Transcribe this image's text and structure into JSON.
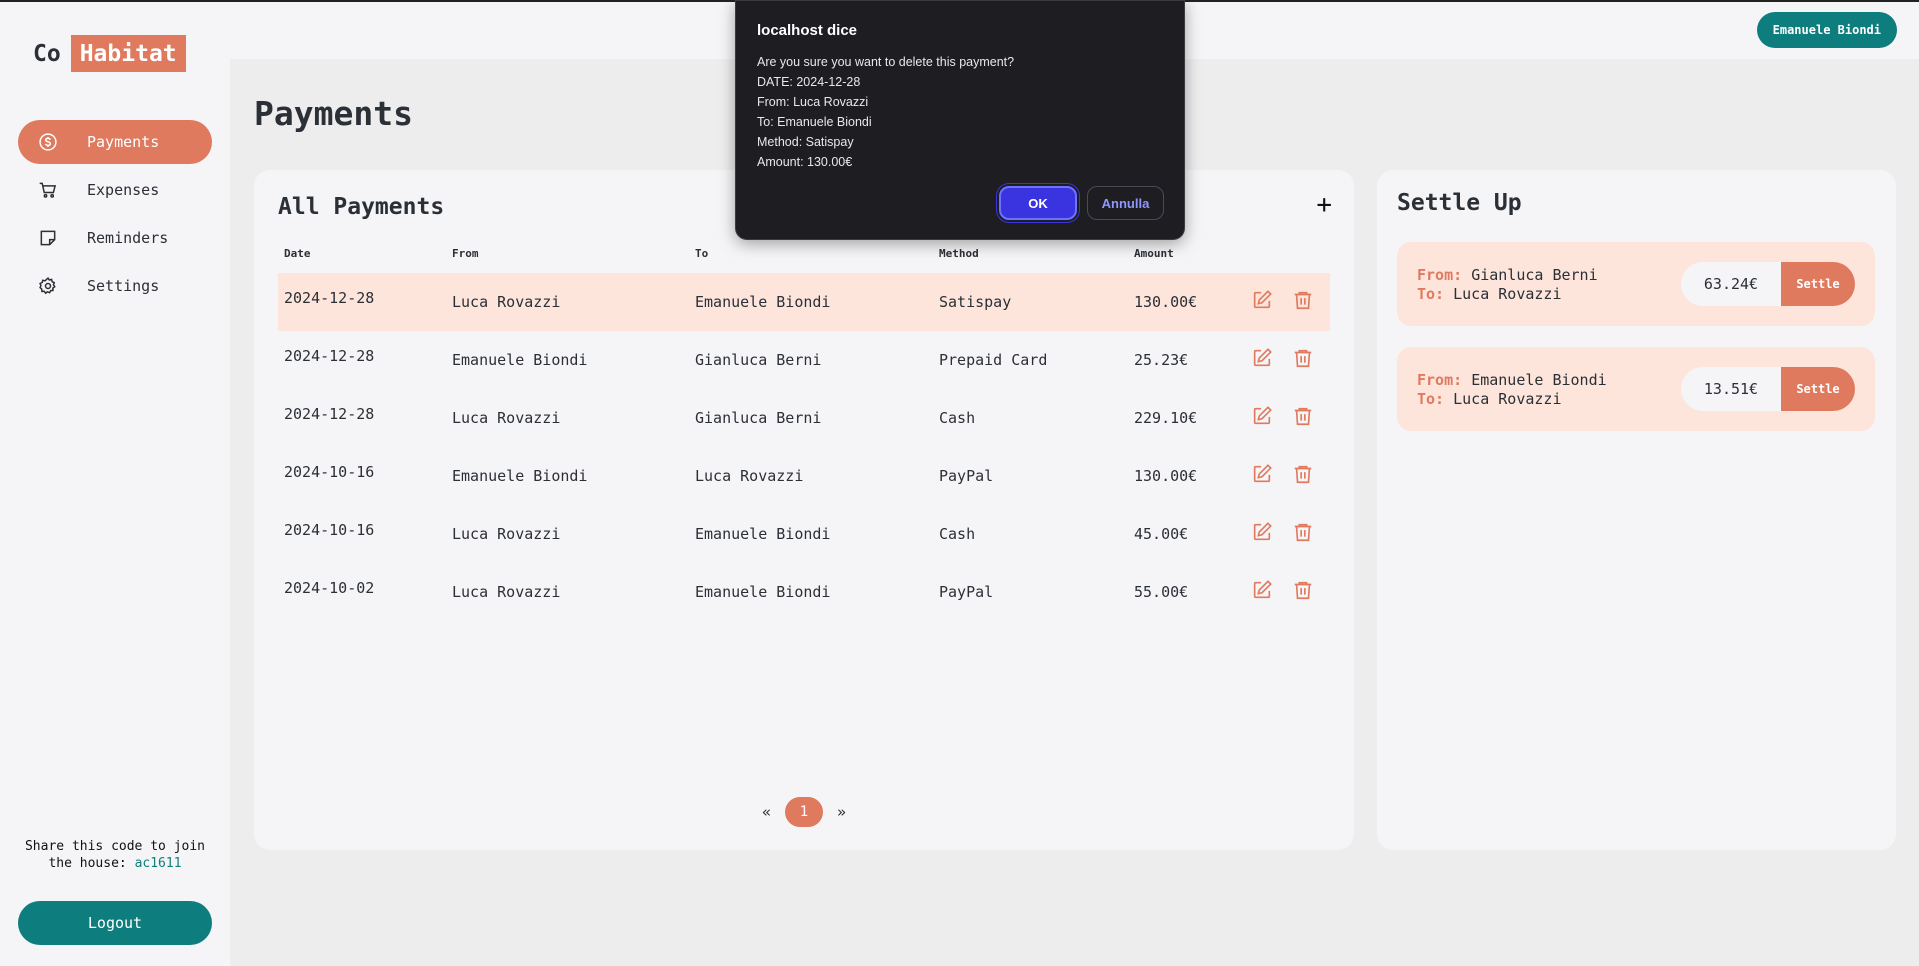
{
  "app": {
    "logo_co": "Co",
    "logo_habitat": "Habitat"
  },
  "colors": {
    "accent": "#e07a5f",
    "teal": "#0d7d7d",
    "highlight_row": "#fde5dc",
    "dialog_ok": "#3a33e0"
  },
  "sidebar": {
    "items": [
      {
        "label": "Payments",
        "icon": "dollar-circle-icon",
        "active": true
      },
      {
        "label": "Expenses",
        "icon": "cart-icon",
        "active": false
      },
      {
        "label": "Reminders",
        "icon": "sticky-note-icon",
        "active": false
      },
      {
        "label": "Settings",
        "icon": "gear-icon",
        "active": false
      }
    ],
    "share_text": "Share this code to join the house:",
    "share_code": "ac1611",
    "logout_label": "Logout"
  },
  "header": {
    "user_name": "Emanuele Biondi"
  },
  "page": {
    "title": "Payments"
  },
  "payments": {
    "title": "All Payments",
    "add_label": "+",
    "columns": {
      "date": "Date",
      "from": "From",
      "to": "To",
      "method": "Method",
      "amount": "Amount"
    },
    "rows": [
      {
        "date": "2024-12-28",
        "from": "Luca Rovazzi",
        "to": "Emanuele Biondi",
        "method": "Satispay",
        "amount": "130.00€"
      },
      {
        "date": "2024-12-28",
        "from": "Emanuele Biondi",
        "to": "Gianluca Berni",
        "method": "Prepaid Card",
        "amount": "25.23€"
      },
      {
        "date": "2024-12-28",
        "from": "Luca Rovazzi",
        "to": "Gianluca Berni",
        "method": "Cash",
        "amount": "229.10€"
      },
      {
        "date": "2024-10-16",
        "from": "Emanuele Biondi",
        "to": "Luca Rovazzi",
        "method": "PayPal",
        "amount": "130.00€"
      },
      {
        "date": "2024-10-16",
        "from": "Luca Rovazzi",
        "to": "Emanuele Biondi",
        "method": "Cash",
        "amount": "45.00€"
      },
      {
        "date": "2024-10-02",
        "from": "Luca Rovazzi",
        "to": "Emanuele Biondi",
        "method": "PayPal",
        "amount": "55.00€"
      }
    ],
    "pagination": {
      "prev": "«",
      "current": "1",
      "next": "»"
    }
  },
  "settle": {
    "title": "Settle Up",
    "from_label": "From:",
    "to_label": "To:",
    "button_label": "Settle",
    "items": [
      {
        "from": "Gianluca Berni",
        "to": "Luca Rovazzi",
        "amount": "63.24€"
      },
      {
        "from": "Emanuele Biondi",
        "to": "Luca Rovazzi",
        "amount": "13.51€"
      }
    ]
  },
  "dialog": {
    "title": "localhost dice",
    "lines": [
      "Are you sure you want to delete this payment?",
      "DATE: 2024-12-28",
      "From: Luca Rovazzi",
      "To: Emanuele Biondi",
      "Method: Satispay",
      "Amount: 130.00€"
    ],
    "ok_label": "OK",
    "cancel_label": "Annulla"
  }
}
